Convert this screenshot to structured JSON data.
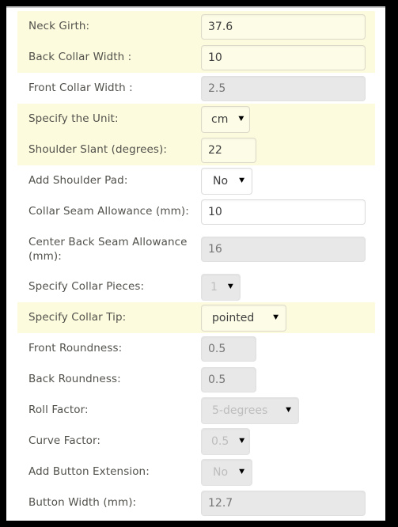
{
  "form": {
    "rows": [
      {
        "label": "Neck Girth:",
        "control": "text",
        "value": "37.6",
        "placeholder": "",
        "disabled": false,
        "highlighted": true,
        "width": "wide",
        "name": "neck-girth"
      },
      {
        "label": "Back Collar Width :",
        "control": "text",
        "value": "10",
        "placeholder": "",
        "disabled": false,
        "highlighted": true,
        "width": "wide",
        "name": "back-collar-width"
      },
      {
        "label": "Front Collar Width :",
        "control": "text",
        "value": "",
        "placeholder": "2.5",
        "disabled": true,
        "highlighted": false,
        "width": "wide",
        "name": "front-collar-width"
      },
      {
        "label": "Specify the Unit:",
        "control": "select",
        "value": "cm",
        "disabled": false,
        "highlighted": true,
        "width": "w-unit",
        "name": "specify-the-unit"
      },
      {
        "label": "Shoulder Slant (degrees):",
        "control": "text",
        "value": "22",
        "placeholder": "",
        "disabled": false,
        "highlighted": true,
        "width": "narrow",
        "name": "shoulder-slant"
      },
      {
        "label": "Add Shoulder Pad:",
        "control": "select",
        "value": "No",
        "disabled": false,
        "highlighted": false,
        "width": "w-yn",
        "name": "add-shoulder-pad"
      },
      {
        "label": "Collar Seam Allowance (mm):",
        "control": "text",
        "value": "10",
        "placeholder": "",
        "disabled": false,
        "highlighted": false,
        "width": "xwide",
        "name": "collar-seam-allowance"
      },
      {
        "label": "Center Back Seam Allowance (mm):",
        "control": "text",
        "value": "",
        "placeholder": "16",
        "disabled": true,
        "highlighted": false,
        "width": "xwide",
        "tall": true,
        "name": "center-back-seam-allowance"
      },
      {
        "label": "Specify Collar Pieces:",
        "control": "select",
        "value": "1",
        "disabled": true,
        "highlighted": false,
        "width": "w-num",
        "name": "specify-collar-pieces"
      },
      {
        "label": "Specify Collar Tip:",
        "control": "select",
        "value": "pointed",
        "disabled": false,
        "highlighted": true,
        "width": "w-tip",
        "name": "specify-collar-tip"
      },
      {
        "label": "Front Roundness:",
        "control": "text",
        "value": "",
        "placeholder": "0.5",
        "disabled": true,
        "highlighted": false,
        "width": "narrow",
        "name": "front-roundness"
      },
      {
        "label": "Back Roundness:",
        "control": "text",
        "value": "",
        "placeholder": "0.5",
        "disabled": true,
        "highlighted": false,
        "width": "narrow",
        "name": "back-roundness"
      },
      {
        "label": "Roll Factor:",
        "control": "select",
        "value": "5-degrees",
        "disabled": true,
        "highlighted": false,
        "width": "w-roll",
        "name": "roll-factor"
      },
      {
        "label": "Curve Factor:",
        "control": "select",
        "value": "0.5",
        "disabled": true,
        "highlighted": false,
        "width": "w-curve",
        "name": "curve-factor"
      },
      {
        "label": "Add Button Extension:",
        "control": "select",
        "value": "No",
        "disabled": true,
        "highlighted": false,
        "width": "w-yn",
        "name": "add-button-extension"
      },
      {
        "label": "Button Width (mm):",
        "control": "text",
        "value": "",
        "placeholder": "12.7",
        "disabled": true,
        "highlighted": false,
        "width": "xwide",
        "name": "button-width"
      }
    ],
    "dropdown_arrow_glyph": "▼"
  },
  "theme": {
    "highlight_color": "#fcfbdd",
    "page_background": "#ffffff",
    "frame_color": "#000000",
    "label_color": "#52514c",
    "disabled_field_color": "#e8e8e8",
    "disabled_text_color": "#bcbcbc"
  }
}
